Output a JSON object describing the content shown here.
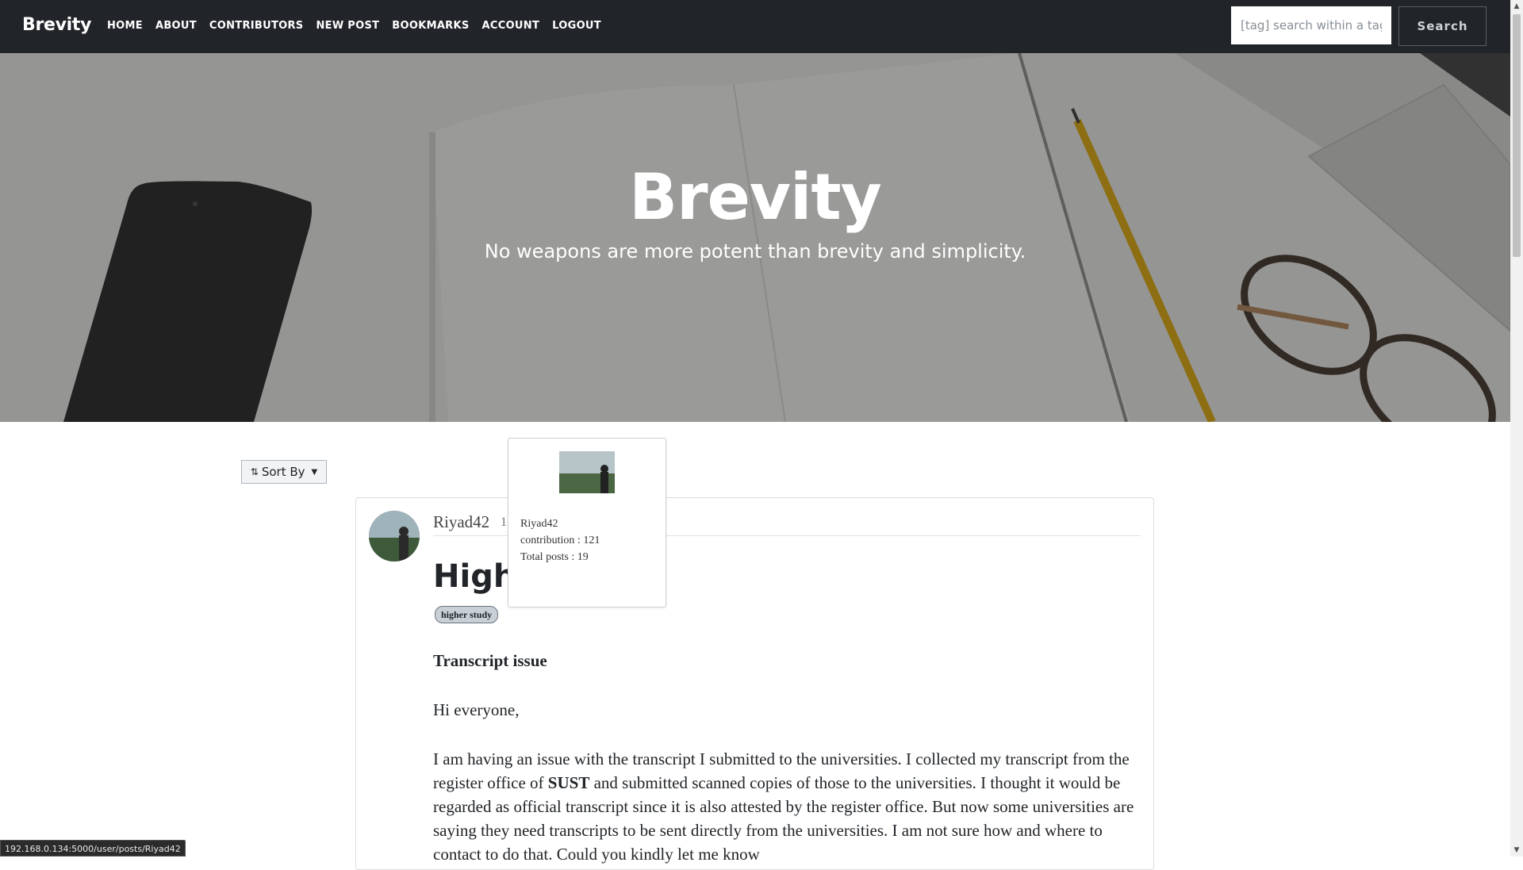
{
  "navbar": {
    "brand": "Brevity",
    "links": [
      "HOME",
      "ABOUT",
      "CONTRIBUTORS",
      "NEW POST",
      "BOOKMARKS",
      "ACCOUNT",
      "LOGOUT"
    ],
    "search_placeholder": "[tag] search within a tag",
    "search_button": "Search"
  },
  "hero": {
    "title": "Brevity",
    "subtitle": "No weapons are more potent than brevity and simplicity."
  },
  "sort": {
    "label": "Sort By"
  },
  "post": {
    "author": "Riyad42",
    "date_fragment": "1",
    "title": "Highe",
    "tag": "higher study",
    "subheading": "Transcript issue",
    "greeting": "Hi everyone,",
    "body_part1": "I am having an issue with the transcript I submitted to the universities. I collected my transcript from the register office of ",
    "body_bold": "SUST",
    "body_part2": " and submitted scanned copies of those to the universities. I thought it would be regarded as official transcript since it is also attested by the register office. But now some universities are saying they need transcripts to be sent directly from the universities. I am not sure how and where to contact to do that. Could you kindly let me know"
  },
  "popover": {
    "username": "Riyad42",
    "contribution": "contribution : 121",
    "total_posts": "Total posts : 19"
  },
  "status_bar": {
    "url": "192.168.0.134:5000/user/posts/Riyad42"
  },
  "colors": {
    "navbar_bg": "#212529",
    "tag_bg": "#c9cfd6"
  }
}
